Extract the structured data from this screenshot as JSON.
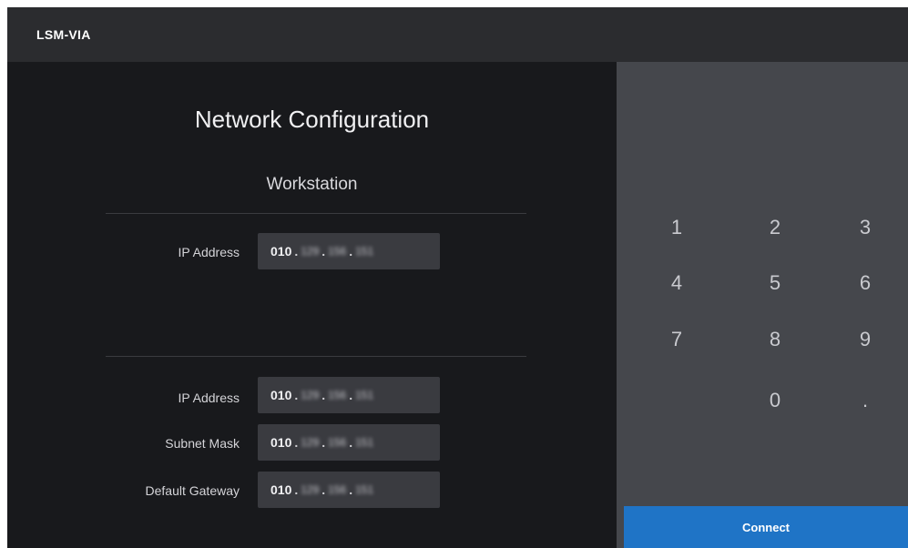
{
  "app": {
    "title": "LSM-VIA"
  },
  "form": {
    "title": "Network Configuration",
    "section_title": "Workstation",
    "workstation_ip": {
      "label": "IP Address",
      "octet1": "010",
      "octet2": "129",
      "octet3": "156",
      "octet4": "151"
    },
    "device_ip": {
      "label": "IP Address",
      "octet1": "010",
      "octet2": "129",
      "octet3": "156",
      "octet4": "151"
    },
    "subnet_mask": {
      "label": "Subnet Mask",
      "octet1": "010",
      "octet2": "129",
      "octet3": "156",
      "octet4": "151"
    },
    "default_gateway": {
      "label": "Default Gateway",
      "octet1": "010",
      "octet2": "129",
      "octet3": "156",
      "octet4": "151"
    }
  },
  "keypad": {
    "keys": [
      "1",
      "2",
      "3",
      "4",
      "5",
      "6",
      "7",
      "8",
      "9",
      "0",
      "."
    ],
    "connect_label": "Connect"
  },
  "colors": {
    "background": "#18191c",
    "topbar": "#2b2c2f",
    "keypad_panel": "#45474c",
    "field": "#3a3b40",
    "accent": "#1f74c6"
  }
}
